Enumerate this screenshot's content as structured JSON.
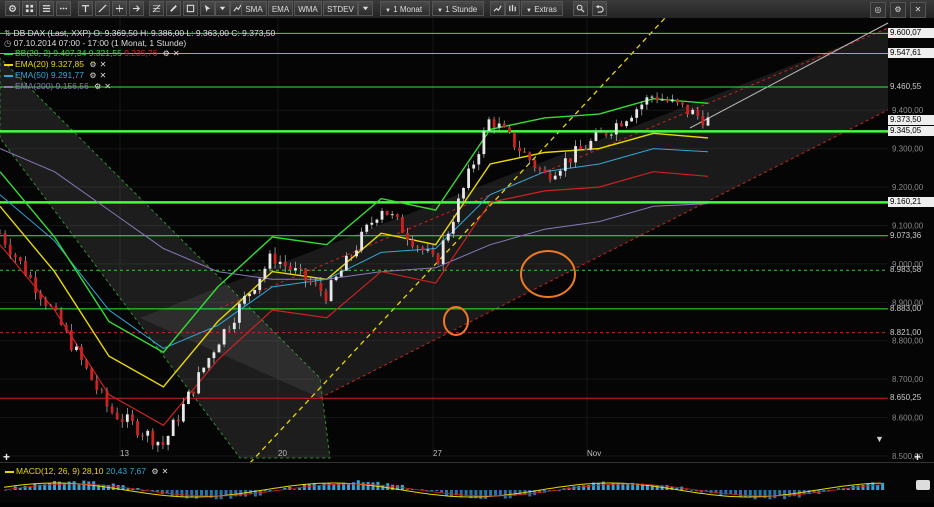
{
  "toolbar": {
    "indicator_buttons": [
      "SMA",
      "EMA",
      "WMA",
      "STDEV"
    ],
    "period_select": "1 Monat",
    "interval_select": "1 Stunde",
    "extras_label": "Extras",
    "icons": [
      "settings-icon",
      "grid-icon",
      "list-icon",
      "more-icon",
      "text-tool-icon",
      "line-tool-icon",
      "pencil-icon",
      "ray-icon",
      "channel-icon",
      "rect-icon",
      "cursor-icon",
      "dropdown-icon",
      "undo-icon",
      "redo-icon"
    ]
  },
  "header": {
    "title": "DB DAX (Last, XXP)  O: 9.369,50  H: 9.386,00  L: 9.363,00  C: 9.373,50",
    "range": "07.10.2014 07:00 - 17:00 (1 Monat, 1 Stunde)"
  },
  "legend": [
    {
      "name": "BB(20, 2)",
      "values": "9.407,34  9.321,55",
      "extra": "9.235,76",
      "color": "#33dd33",
      "extra_color": "#dd2222"
    },
    {
      "name": "EMA(20)",
      "values": "9.327,85",
      "color": "#e8d800"
    },
    {
      "name": "EMA(50)",
      "values": "9.291,77",
      "color": "#2fa8d8"
    },
    {
      "name": "EMA(200)",
      "values": "9.156,56",
      "color": "#8878b8"
    }
  ],
  "macd_legend": {
    "name": "MACD(12, 26, 9)",
    "values": "28,10",
    "v2": "20,43",
    "v3": "7,67"
  },
  "price_axis": {
    "ticks": [
      "9.400,00",
      "9.300,00",
      "9.200,00",
      "9.100,00",
      "9.000,00",
      "8.900,00",
      "8.800,00",
      "8.700,00",
      "8.600,00",
      "8.500,00"
    ],
    "levels": [
      {
        "label": "9.600,07",
        "color": "#33ee33",
        "style": "solid",
        "box": true
      },
      {
        "label": "9.547,61",
        "color": "#33ee33",
        "style": "solid",
        "box": true
      },
      {
        "label": "9.460,55",
        "color": "#33ee33",
        "style": "solid",
        "box": false
      },
      {
        "label": "9.373,50",
        "color": "#ffffff",
        "style": "none",
        "box": true
      },
      {
        "label": "9.345,05",
        "color": "#44ff44",
        "style": "thick",
        "box": true
      },
      {
        "label": "9.160,21",
        "color": "#44ff44",
        "style": "thick",
        "box": true
      },
      {
        "label": "9.073,36",
        "color": "#33ee33",
        "style": "solid",
        "box": false
      },
      {
        "label": "8.983,58",
        "color": "#33cc33",
        "style": "dashed",
        "box": false
      },
      {
        "label": "8.883,00",
        "color": "#33ee33",
        "style": "solid",
        "box": false
      },
      {
        "label": "8.821,00",
        "color": "#cc2222",
        "style": "dashed",
        "box": false
      },
      {
        "label": "8.650,25",
        "color": "#cc2222",
        "style": "solid",
        "box": false
      }
    ]
  },
  "x_axis": {
    "labels": [
      "13",
      "20",
      "27",
      "Nov"
    ]
  },
  "chart_data": {
    "type": "line",
    "title": "DB DAX (Last, XXP)",
    "xlabel": "",
    "ylabel": "",
    "ylim": [
      8500,
      9640
    ],
    "x": [
      "13",
      "20",
      "27",
      "Nov"
    ],
    "series": [
      {
        "name": "DB DAX",
        "values": [
          9080,
          8870,
          8620,
          8530,
          8800,
          9020,
          8920,
          9150,
          9000,
          9380,
          9230,
          9330,
          9440,
          9373
        ]
      },
      {
        "name": "EMA(20)",
        "values": [
          9150,
          8980,
          8760,
          8680,
          8850,
          8980,
          8960,
          9080,
          9050,
          9260,
          9290,
          9300,
          9340,
          9328
        ]
      },
      {
        "name": "EMA(50)",
        "values": [
          9180,
          9060,
          8880,
          8780,
          8840,
          8940,
          8960,
          9030,
          9040,
          9180,
          9240,
          9260,
          9300,
          9292
        ]
      },
      {
        "name": "EMA(200)",
        "values": [
          9300,
          9240,
          9140,
          9040,
          8980,
          8960,
          8960,
          8980,
          8990,
          9050,
          9090,
          9110,
          9150,
          9157
        ]
      }
    ]
  },
  "window_controls": {
    "right_icons": [
      "dropdown-icon",
      "undo-icon",
      "redo-icon"
    ]
  }
}
